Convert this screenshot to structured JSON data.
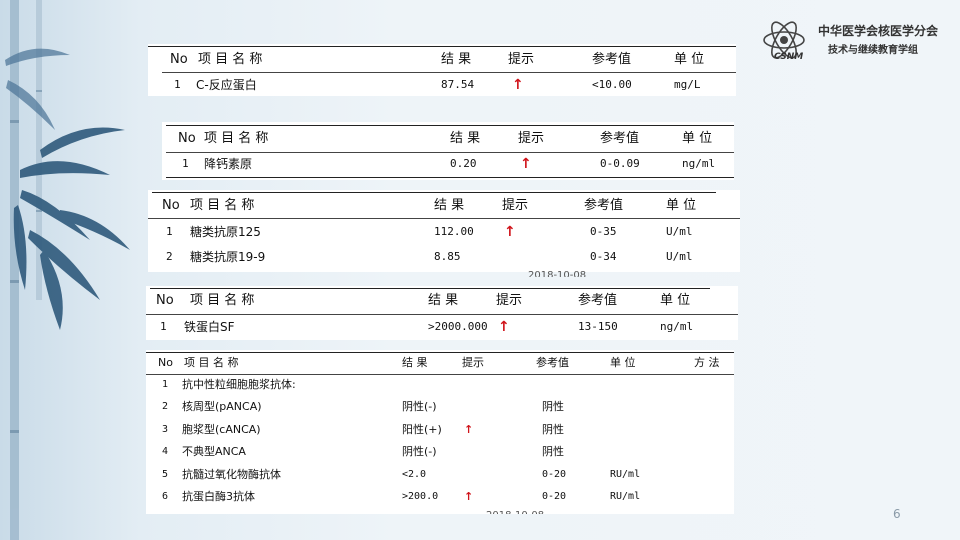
{
  "colors": {
    "arrow": "#d0141b",
    "bamboo": "#3a6688"
  },
  "logo": {
    "title": "中华医学会核医学分会",
    "subtitle": "技术与继续教育学组",
    "mark_text": "CSNM"
  },
  "page_number": "6",
  "panel1": {
    "headers": {
      "no": "No",
      "name": "项 目 名 称",
      "result": "结 果",
      "hint": "提示",
      "ref": "参考值",
      "unit": "单 位"
    },
    "rows": [
      {
        "no": "1",
        "name": "C-反应蛋白",
        "result": "87.54",
        "hint": "↑",
        "ref": "<10.00",
        "unit": "mg/L"
      }
    ]
  },
  "panel2": {
    "headers": {
      "no": "No",
      "name": "项 目 名 称",
      "result": "结 果",
      "hint": "提示",
      "ref": "参考值",
      "unit": "单 位"
    },
    "rows": [
      {
        "no": "1",
        "name": "降钙素原",
        "result": "0.20",
        "hint": "↑",
        "ref": "0-0.09",
        "unit": "ng/ml"
      }
    ]
  },
  "panel3": {
    "headers": {
      "no": "No",
      "name": "项 目 名 称",
      "result": "结 果",
      "hint": "提示",
      "ref": "参考值",
      "unit": "单 位"
    },
    "rows": [
      {
        "no": "1",
        "name": "糖类抗原125",
        "result": "112.00",
        "hint": "↑",
        "ref": "0-35",
        "unit": "U/ml"
      },
      {
        "no": "2",
        "name": "糖类抗原19-9",
        "result": "8.85",
        "hint": "",
        "ref": "0-34",
        "unit": "U/ml"
      }
    ],
    "clipped_text": "2018-10-08"
  },
  "panel4": {
    "headers": {
      "no": "No",
      "name": "项 目 名 称",
      "result": "结 果",
      "hint": "提示",
      "ref": "参考值",
      "unit": "单 位"
    },
    "rows": [
      {
        "no": "1",
        "name": "铁蛋白SF",
        "result": ">2000.000",
        "hint": "↑",
        "ref": "13-150",
        "unit": "ng/ml"
      }
    ]
  },
  "panel5": {
    "headers": {
      "no": "No",
      "name": "项 目 名 称",
      "result": "结 果",
      "hint": "提示",
      "ref": "参考值",
      "unit": "单 位",
      "method": "方 法"
    },
    "rows": [
      {
        "no": "1",
        "name": "抗中性粒细胞胞浆抗体:",
        "result": "",
        "hint": "",
        "ref": "",
        "unit": ""
      },
      {
        "no": "2",
        "name": "核周型(pANCA)",
        "result": "阴性(-)",
        "hint": "",
        "ref": "阴性",
        "unit": ""
      },
      {
        "no": "3",
        "name": "胞浆型(cANCA)",
        "result": "阳性(+)",
        "hint": "↑",
        "ref": "阴性",
        "unit": ""
      },
      {
        "no": "4",
        "name": "不典型ANCA",
        "result": "阴性(-)",
        "hint": "",
        "ref": "阴性",
        "unit": ""
      },
      {
        "no": "5",
        "name": "抗髓过氧化物酶抗体",
        "result": "<2.0",
        "hint": "",
        "ref": "0-20",
        "unit": "RU/ml"
      },
      {
        "no": "6",
        "name": "抗蛋白酶3抗体",
        "result": ">200.0",
        "hint": "↑",
        "ref": "0-20",
        "unit": "RU/ml"
      }
    ],
    "clipped_text": "2018-10-08"
  }
}
